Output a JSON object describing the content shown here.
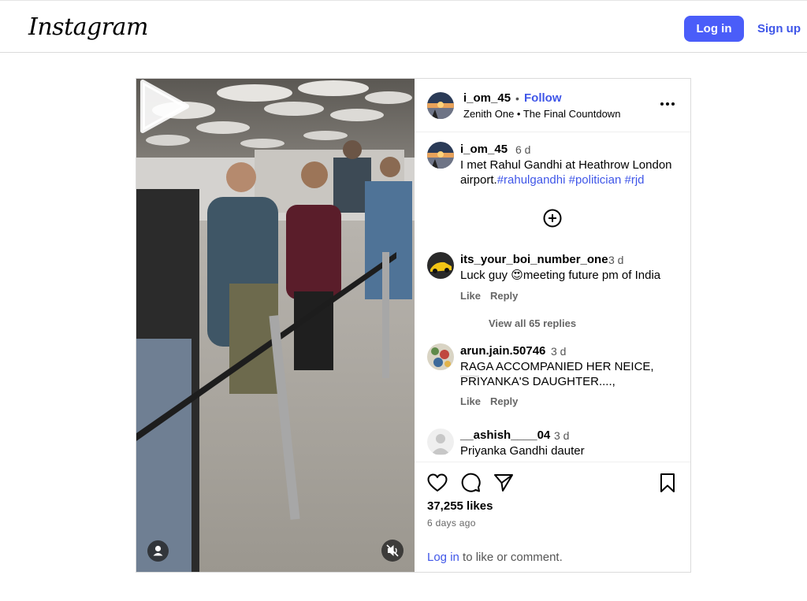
{
  "header": {
    "logo": "Instagram",
    "login": "Log in",
    "signup": "Sign up"
  },
  "post": {
    "author": "i_om_45",
    "dot": "•",
    "follow": "Follow",
    "subtitle": "Zenith One • The Final Countdown",
    "caption": {
      "username": "i_om_45",
      "time": "6 d",
      "text": "I met Rahul Gandhi at Heathrow London airport.",
      "hashtags": [
        "#rahulgandhi",
        "#politician",
        "#rjd"
      ]
    },
    "comments": [
      {
        "username": "its_your_boi_number_one",
        "time": "3 d",
        "text_before": "Luck guy ",
        "emoji": "😍",
        "text_after": "meeting future pm of India",
        "like": "Like",
        "reply": "Reply",
        "view_replies": "View all 65 replies"
      },
      {
        "username": "arun.jain.50746",
        "time": "3 d",
        "line1": "RAGA ACCOMPANIED HER NEICE,",
        "line2": "PRIYANKA'S DAUGHTER....,",
        "like": "Like",
        "reply": "Reply"
      },
      {
        "username": "__ashish____04",
        "time": "3 d",
        "text": "Priyanka Gandhi dauter"
      }
    ],
    "likes": "37,255 likes",
    "posted": "6 days ago",
    "login_prompt": {
      "link": "Log in",
      "rest": " to like or comment."
    }
  },
  "icons": [
    "more-options-icon",
    "add-comment-icon",
    "heart-icon",
    "comment-icon",
    "share-icon",
    "bookmark-icon",
    "play-icon",
    "user-tag-icon",
    "mute-icon",
    "default-avatar-icon"
  ]
}
